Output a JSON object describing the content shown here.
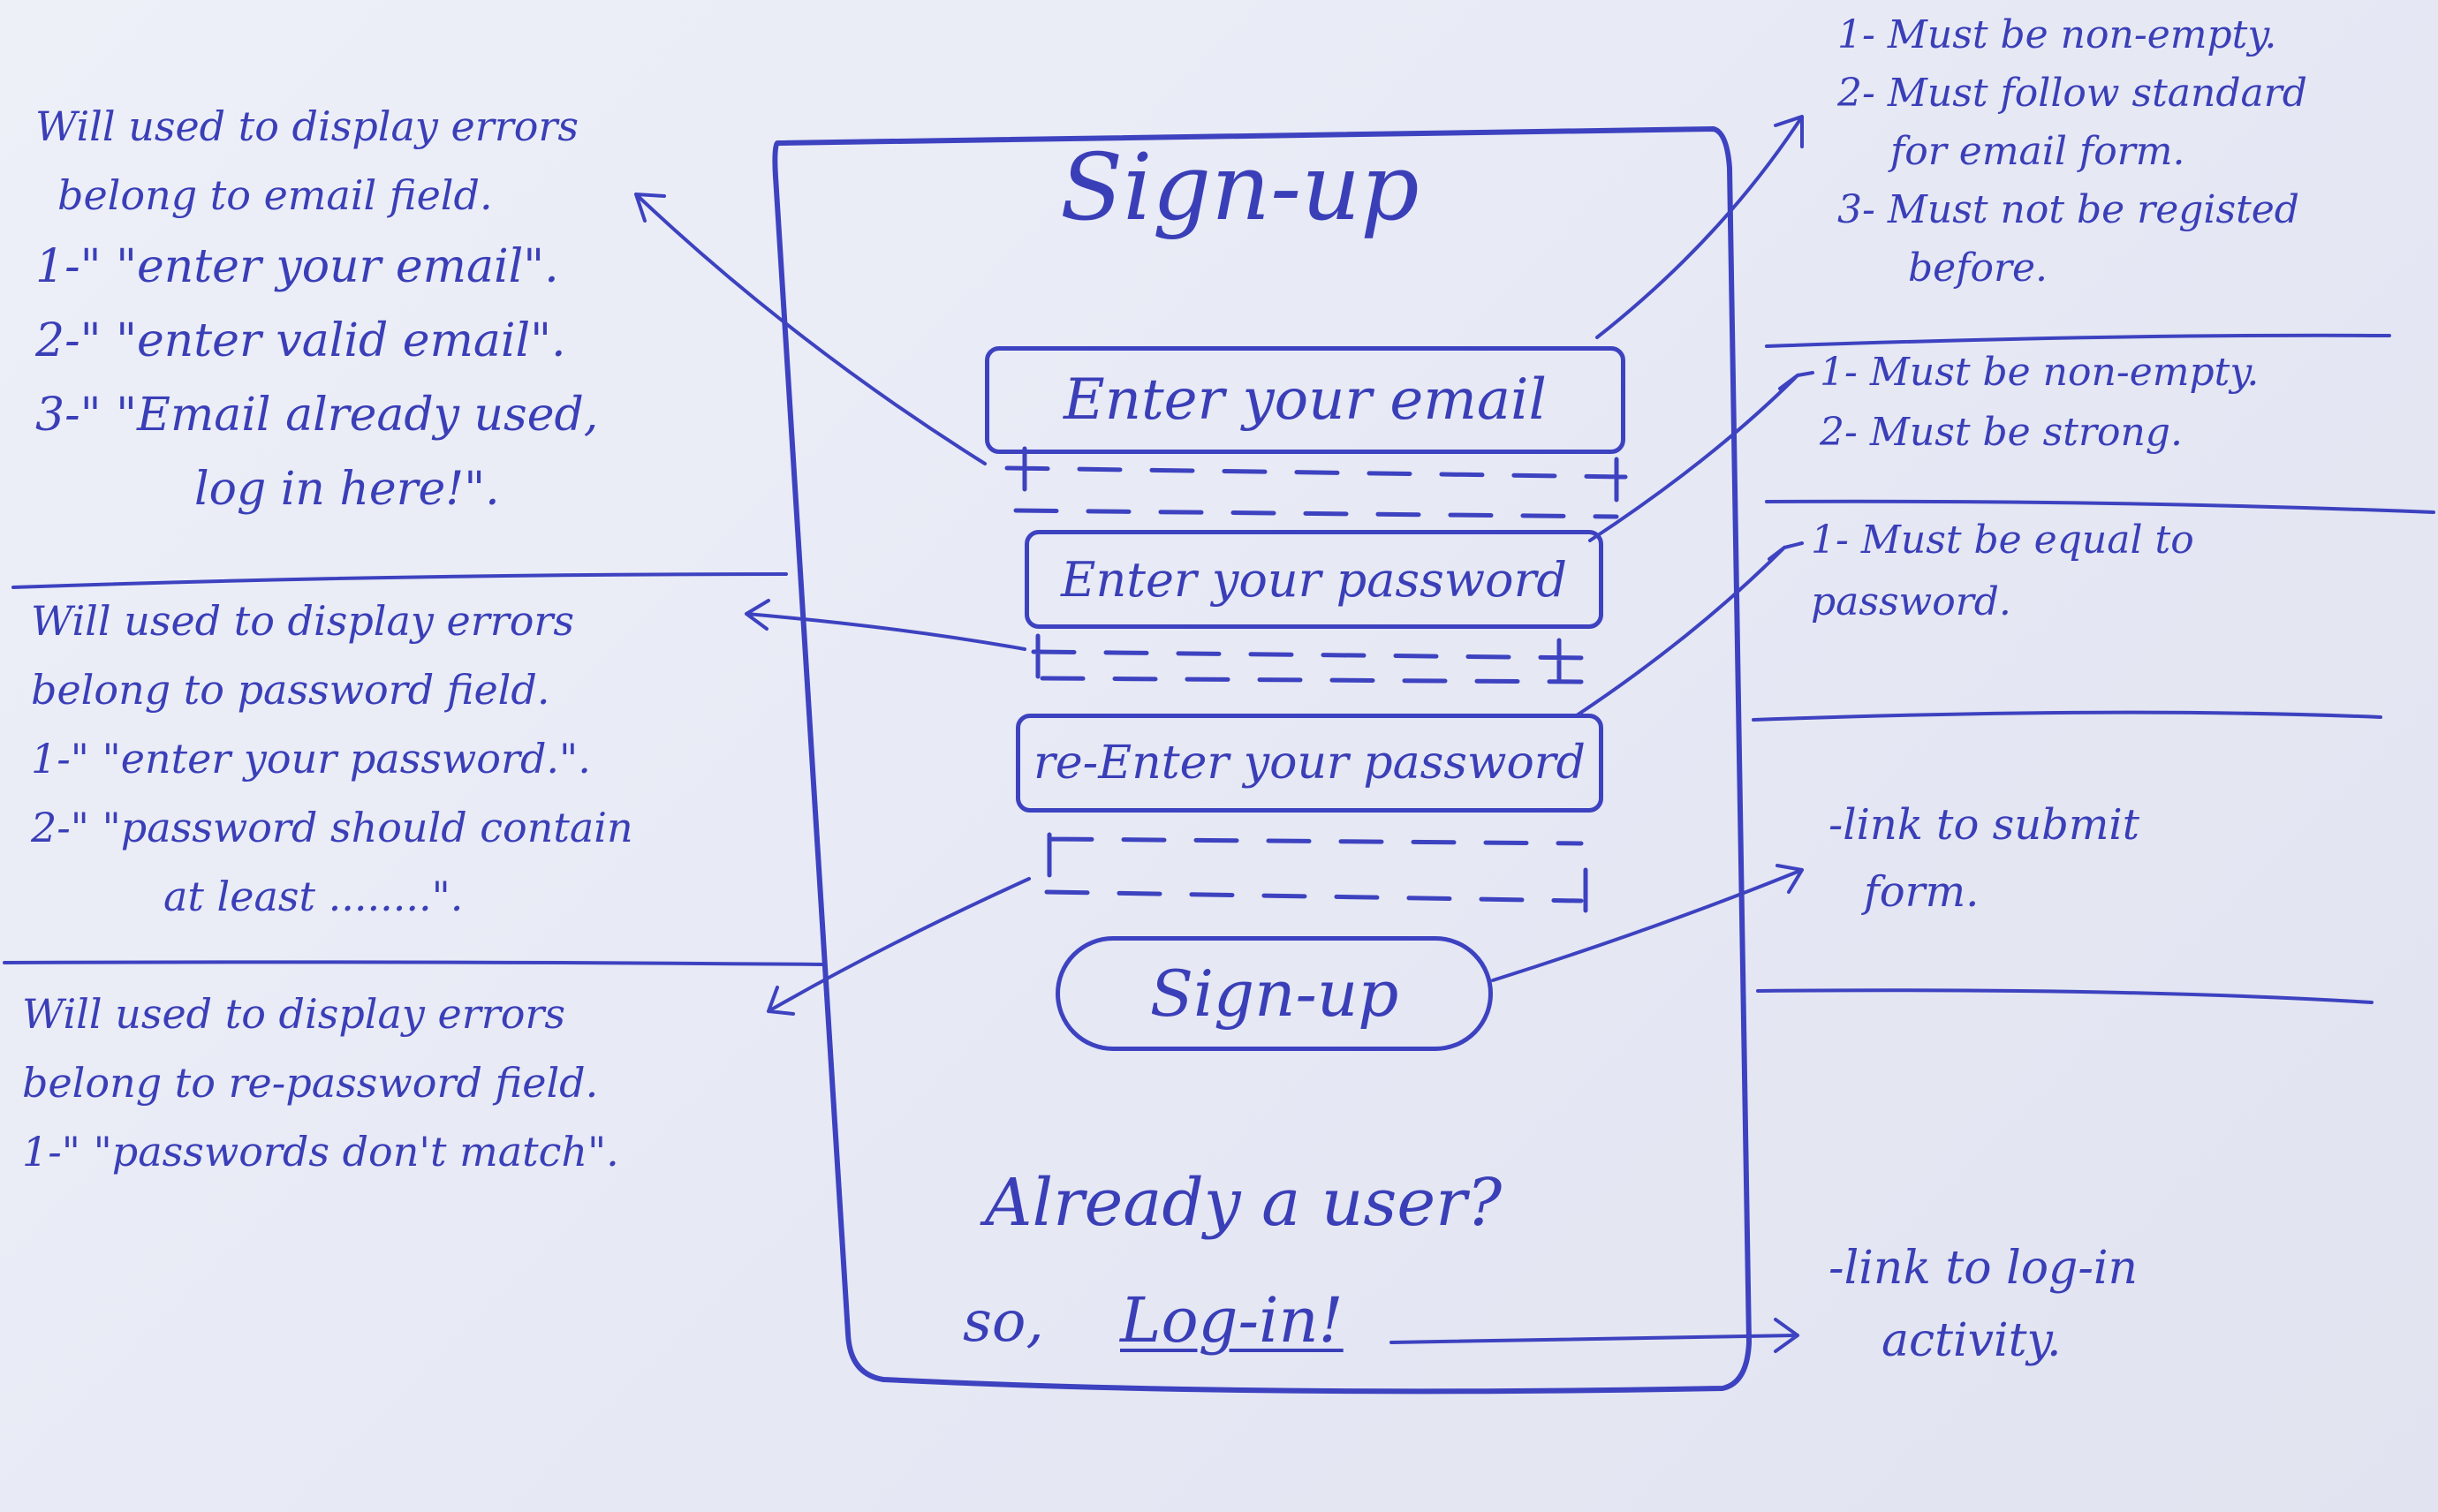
{
  "form": {
    "title": "Sign-up",
    "email_placeholder": "Enter your email",
    "password_placeholder": "Enter your password",
    "repassword_placeholder": "re-Enter your password",
    "submit_label": "Sign-up",
    "already_user": "Already a user?",
    "so_prefix": "so,",
    "login_link": "Log-in!"
  },
  "left_notes": {
    "email_errors": [
      "Will used to display errors",
      "belong to email field.",
      "1-\" \"enter your email\".",
      "2-\" \"enter valid email\".",
      "3-\" \"Email already used,",
      "log in here!\"."
    ],
    "password_errors": [
      "Will used to display errors",
      "belong to password field.",
      "1-\" \"enter your password.\".",
      "2-\" \"password should contain",
      "at least ........\"."
    ],
    "repassword_errors": [
      "Will used to display errors",
      "belong to re-password field.",
      "1-\" \"passwords don't match\"."
    ]
  },
  "right_notes": {
    "email_rules": [
      "1- Must be non-empty.",
      "2- Must follow standard",
      "for email form.",
      "3- Must not be registed",
      "before."
    ],
    "password_rules": [
      "1- Must be non-empty.",
      "2- Must be strong."
    ],
    "repassword_rules": [
      "1- Must be equal to",
      "password."
    ],
    "submit_note": [
      "-link to submit",
      "form."
    ],
    "login_note": [
      "-link to log-in",
      "activity."
    ]
  }
}
